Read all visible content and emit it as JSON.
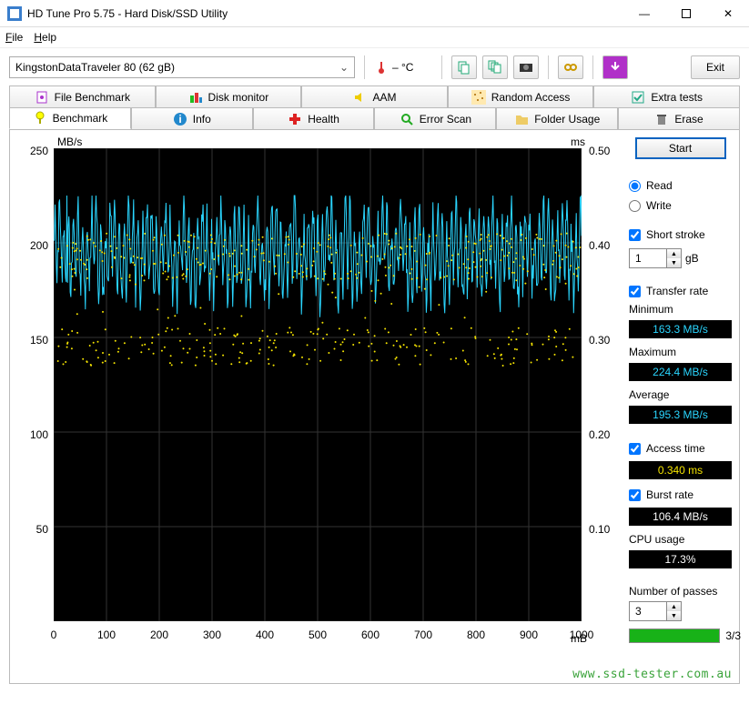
{
  "window": {
    "title": "HD Tune Pro 5.75 - Hard Disk/SSD Utility",
    "min": "—",
    "max": "▢",
    "close": "✕"
  },
  "menu": {
    "file": "File",
    "help": "Help"
  },
  "toolbar": {
    "device": "KingstonDataTraveler 80 (62 gB)",
    "temp": "– °C",
    "exit": "Exit"
  },
  "tabs_row1": [
    "File Benchmark",
    "Disk monitor",
    "AAM",
    "Random Access",
    "Extra tests"
  ],
  "tabs_row2": [
    "Benchmark",
    "Info",
    "Health",
    "Error Scan",
    "Folder Usage",
    "Erase"
  ],
  "chart_data": {
    "type": "line+scatter",
    "xlabel": "mB",
    "ylabel_left": "MB/s",
    "ylabel_right": "ms",
    "x_ticks": [
      0,
      100,
      200,
      300,
      400,
      500,
      600,
      700,
      800,
      900,
      1000
    ],
    "y_left_ticks": [
      50,
      100,
      150,
      200,
      250
    ],
    "y_right_ticks": [
      0.1,
      0.2,
      0.3,
      0.4,
      0.5
    ],
    "xlim": [
      0,
      1000
    ],
    "ylim_left": [
      0,
      250
    ],
    "ylim_right": [
      0.0,
      0.5
    ],
    "series": [
      {
        "name": "Transfer rate",
        "axis": "left",
        "style": "line",
        "color": "#2ad6ff",
        "summary": {
          "min": 163.3,
          "max": 224.4,
          "avg": 195.3
        },
        "note": "Dense noisy trace oscillating roughly 165–215 MB/s across full 0–1000 mB range"
      },
      {
        "name": "Access time",
        "axis": "right",
        "style": "scatter",
        "color": "#f5e400",
        "summary": {
          "avg": 0.34
        },
        "note": "Scattered points mostly 0.26–0.40 ms across full range"
      }
    ]
  },
  "side": {
    "start": "Start",
    "read": "Read",
    "write": "Write",
    "short_stroke": "Short stroke",
    "short_stroke_val": "1",
    "short_stroke_unit": "gB",
    "transfer_rate": "Transfer rate",
    "minimum": "Minimum",
    "minimum_val": "163.3 MB/s",
    "maximum": "Maximum",
    "maximum_val": "224.4 MB/s",
    "average": "Average",
    "average_val": "195.3 MB/s",
    "access_time": "Access time",
    "access_time_val": "0.340 ms",
    "burst_rate": "Burst rate",
    "burst_rate_val": "106.4 MB/s",
    "cpu_usage": "CPU usage",
    "cpu_usage_val": "17.3%",
    "num_passes": "Number of passes",
    "num_passes_val": "3",
    "progress_txt": "3/3"
  },
  "watermark": "www.ssd-tester.com.au"
}
